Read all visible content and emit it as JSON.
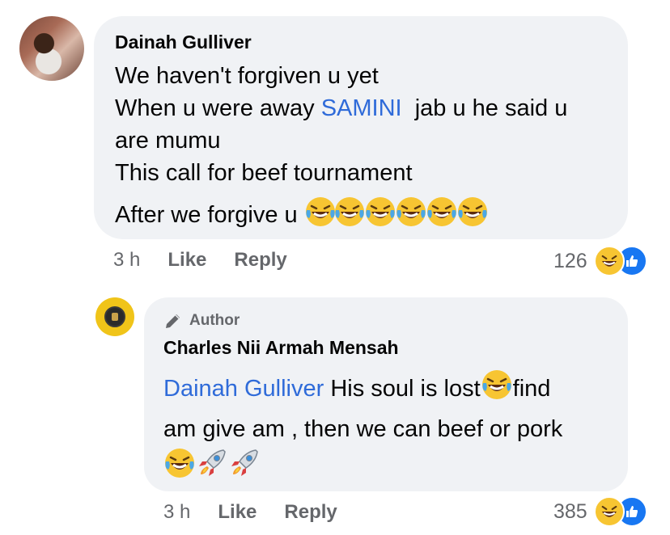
{
  "comment": {
    "author": "Dainah Gulliver",
    "lines": [
      "We haven't forgiven u yet",
      "When u were away",
      "SAMINI",
      "jab u he said u",
      "are mumu",
      "This call for beef tournament",
      "After we forgive u"
    ],
    "time": "3 h",
    "like_label": "Like",
    "reply_label": "Reply",
    "reaction_count": "126"
  },
  "reply": {
    "badge": "Author",
    "author": "Charles Nii Armah Mensah",
    "mention": "Dainah Gulliver",
    "text1": "His soul is lost",
    "text2": "find",
    "text3": "am give am , then we can beef or pork",
    "time": "3 h",
    "like_label": "Like",
    "reply_label": "Reply",
    "reaction_count": "385"
  },
  "colors": {
    "bubble": "#f0f2f5",
    "link": "#2f6bd9",
    "muted": "#65676b",
    "like_blue": "#1877f2",
    "haha_yellow": "#f7c532"
  },
  "icons": [
    "laughing-tears-icon",
    "rocket-icon",
    "pencil-icon",
    "haha-reaction-icon",
    "like-reaction-icon"
  ]
}
